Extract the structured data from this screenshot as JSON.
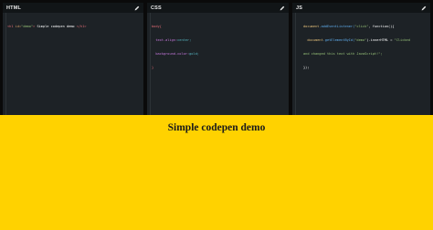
{
  "panes": {
    "html": {
      "title": "HTML",
      "code": {
        "open": "<h1",
        "attr": " id=",
        "id": "\"demo\"",
        "close_open": ">",
        "text": " Simple codepen demo ",
        "end": "</h1>"
      }
    },
    "css": {
      "title": "CSS",
      "code": {
        "selector": "body{",
        "prop1": "  text-align:",
        "val1": "center;",
        "prop2": "  background-color:",
        "val2": "gold;",
        "close": "}"
      }
    },
    "js": {
      "title": "JS",
      "code": {
        "line1_obj": "document",
        "line1_rest": ".addEventListener(",
        "line1_str": "\"click\"",
        "line1_end": ", function(){",
        "line2_obj": "  document",
        "line2_rest": ".getElementById(",
        "line2_str": "\"demo\"",
        "line2_end": ").innerHTML = ",
        "line2_str2": "\"Clicked",
        "line3": "and changed this text with JavaScript!\";",
        "line4": "});"
      }
    }
  },
  "preview": {
    "heading": "Simple codepen demo"
  },
  "colors": {
    "preview_bg": "#ffd200",
    "editor_bg": "#1d2226",
    "header_bg": "#111517"
  },
  "icons": {
    "edit": "pencil-icon"
  }
}
